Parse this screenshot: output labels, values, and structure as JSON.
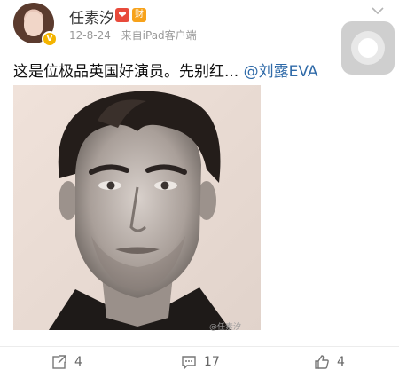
{
  "post": {
    "username": "任素汐",
    "badge_heart": "❤",
    "badge_fortune": "财",
    "date": "12-8-24",
    "source": "来自iPad客户端",
    "text": "这是位极品英国好演员。先别红...",
    "mention": "@刘露EVA",
    "watermark": "@任素汐"
  },
  "actions": {
    "repost_count": "4",
    "comment_count": "17",
    "like_count": "4"
  },
  "icons": {
    "verified": "verified-v-icon",
    "chevron": "chevron-down-icon",
    "floating": "assistive-touch-icon",
    "repost": "repost-icon",
    "comment": "comment-icon",
    "like": "thumbs-up-icon"
  },
  "colors": {
    "mention": "#2f6aa8",
    "verified": "#f4b400",
    "badge_red": "#e84a3b",
    "badge_orange": "#f7a21a"
  }
}
